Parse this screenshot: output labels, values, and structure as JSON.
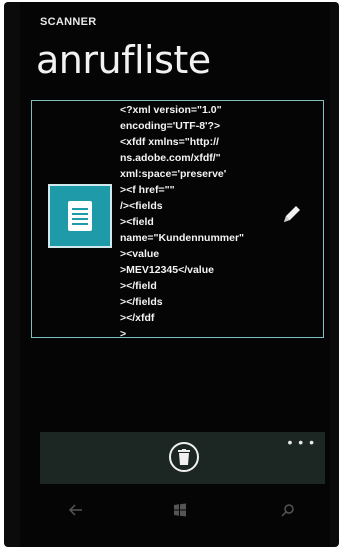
{
  "header": {
    "app_name": "SCANNER",
    "title": "anrufliste"
  },
  "scan_item": {
    "tile_icon": "document-icon",
    "lines": [
      "<?xml version=\"1.0\"",
      "encoding='UTF-8'?>",
      "<xfdf xmlns=\"http://",
      "ns.adobe.com/xfdf/\"",
      "xml:space='preserve'",
      "><f href=\"\"",
      "/><fields",
      "><field",
      "name=\"Kundennummer\"",
      "><value",
      ">MEV12345</value",
      "></field",
      "></fields",
      "></xfdf",
      ">"
    ],
    "edit_icon": "pencil-icon"
  },
  "appbar": {
    "more_label": "• • •",
    "delete_icon": "trash-icon"
  },
  "navbar": {
    "back_icon": "back-arrow-icon",
    "start_icon": "windows-logo-icon",
    "search_icon": "search-icon"
  },
  "colors": {
    "accent": "#1e9aa8",
    "border": "#7fbfbf",
    "appbar": "#1c2622"
  }
}
